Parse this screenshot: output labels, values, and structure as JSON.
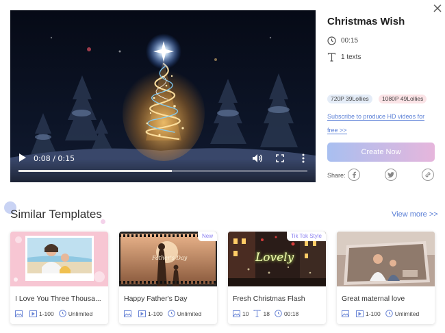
{
  "video": {
    "time": "0:08 / 0:15",
    "progress": 0.53
  },
  "template": {
    "title": "Christmas Wish",
    "duration": "00:15",
    "texts": "1 texts",
    "tags": [
      "720P 39Lollies",
      "1080P 49Lollies"
    ],
    "subscribe_link": "Subscribe to produce HD videos for free >>",
    "create_button": "Create Now",
    "share_label": "Share:"
  },
  "similar": {
    "title": "Similar Templates",
    "view_more": "View more >>",
    "cards": [
      {
        "name": "I Love You Three Thousa...",
        "badge": "",
        "range": "1-100",
        "duration": "Unlimited"
      },
      {
        "name": "Happy Father's Day",
        "badge": "New",
        "range": "1-100",
        "duration": "Unlimited",
        "overlay_text": "Father's Day"
      },
      {
        "name": "Fresh Christmas Flash",
        "badge": "Tik Tok Style",
        "images": "10",
        "texts": "18",
        "duration": "00:18",
        "overlay_text": "Lovely"
      },
      {
        "name": "Great maternal love",
        "badge": "",
        "range": "1-100",
        "duration": "Unlimited"
      }
    ]
  },
  "icons": {
    "close": "close-icon",
    "play": "play-icon",
    "volume": "volume-icon",
    "fullscreen": "fullscreen-icon",
    "more": "more-vertical-icon",
    "clock": "clock-icon",
    "text": "text-icon",
    "facebook": "facebook-icon",
    "twitter": "twitter-icon",
    "link": "link-icon",
    "image": "image-icon",
    "video": "video-icon"
  },
  "colors": {
    "accent_link": "#5a7fd6",
    "button_gradient_start": "#a8bff0",
    "button_gradient_end": "#e6b6dc",
    "tag_720": "#e4ecf7",
    "tag_1080": "#fbe3e6"
  }
}
